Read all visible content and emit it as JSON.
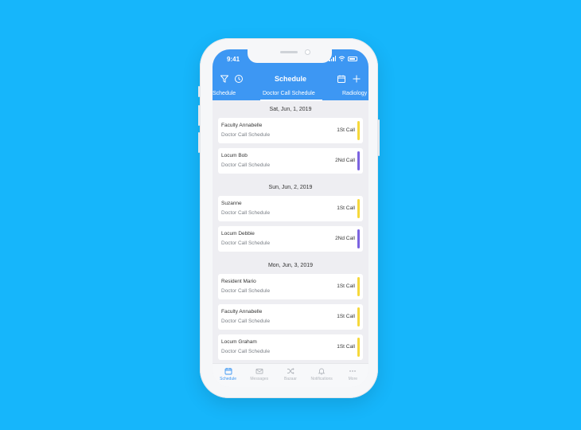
{
  "colors": {
    "background": "#16b6fb",
    "header": "#3d97f3",
    "yellow": "#f6d83a",
    "purple": "#7b63e0"
  },
  "status_bar": {
    "time": "9:41"
  },
  "header": {
    "title": "Schedule"
  },
  "tabs": [
    {
      "label": "Schedule"
    },
    {
      "label": "Doctor Call Schedule"
    },
    {
      "label": "Radiology"
    }
  ],
  "days": [
    {
      "date": "Sat, Jun, 1, 2019",
      "entries": [
        {
          "name": "Faculty Annabelle",
          "subtitle": "Doctor Call Schedule",
          "call": "1St Call",
          "color": "#f6d83a"
        },
        {
          "name": "Locum Bob",
          "subtitle": "Doctor Call Schedule",
          "call": "2Nd Call",
          "color": "#7b63e0"
        }
      ]
    },
    {
      "date": "Sun, Jun, 2, 2019",
      "entries": [
        {
          "name": "Suzanne",
          "subtitle": "Doctor Call Schedule",
          "call": "1St Call",
          "color": "#f6d83a"
        },
        {
          "name": "Locum Debbie",
          "subtitle": "Doctor Call Schedule",
          "call": "2Nd Call",
          "color": "#7b63e0"
        }
      ]
    },
    {
      "date": "Mon, Jun, 3, 2019",
      "entries": [
        {
          "name": "Resident Mario",
          "subtitle": "Doctor Call Schedule",
          "call": "1St Call",
          "color": "#f6d83a"
        },
        {
          "name": "Faculty Annabelle",
          "subtitle": "Doctor Call Schedule",
          "call": "1St Call",
          "color": "#f6d83a"
        },
        {
          "name": "Locum Graham",
          "subtitle": "Doctor Call Schedule",
          "call": "1St Call",
          "color": "#f6d83a"
        },
        {
          "name": "",
          "subtitle": "",
          "call": "",
          "color": "#f6d83a"
        }
      ]
    }
  ],
  "tab_bar": [
    {
      "label": "Schedule",
      "icon": "calendar-icon",
      "active": true
    },
    {
      "label": "Messages",
      "icon": "mail-icon",
      "active": false
    },
    {
      "label": "Bazaar",
      "icon": "shuffle-icon",
      "active": false
    },
    {
      "label": "Notifications",
      "icon": "bell-icon",
      "active": false
    },
    {
      "label": "More",
      "icon": "more-icon",
      "active": false
    }
  ]
}
